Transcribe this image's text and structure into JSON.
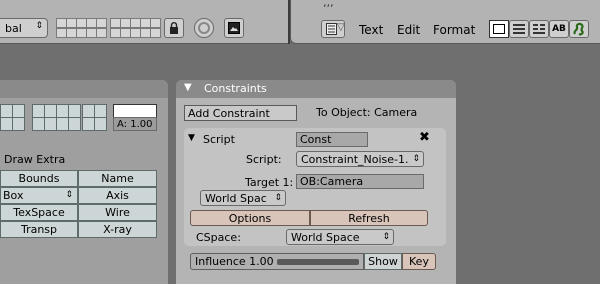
{
  "header_left": {
    "dropdown_value": "bal"
  },
  "header_right": {
    "dots": "‚‚‚",
    "menus": [
      "Text",
      "Edit",
      "Format"
    ],
    "ab_label": "AB"
  },
  "left_panel": {
    "color_value": "A: 1.00",
    "draw_extra_label": "Draw Extra",
    "buttons": [
      [
        "Bounds",
        "Name"
      ],
      [
        "Box",
        "Axis"
      ],
      [
        "TexSpace",
        "Wire"
      ],
      [
        "Transp",
        "X-ray"
      ]
    ]
  },
  "constraints": {
    "panel_title": "Constraints",
    "add_constraint": "Add Constraint",
    "to_object": "To Object: Camera",
    "script": {
      "header_label": "Script",
      "name_value": "Const",
      "script_label": "Script:",
      "script_value": "Constraint_Noise-1.",
      "target_label": "Target 1:",
      "target_value": "OB:Camera",
      "space_value": "World Spac",
      "options_label": "Options",
      "refresh_label": "Refresh",
      "cspace_label": "CSpace:",
      "cspace_value": "World Space"
    },
    "influence_label": "Influence 1.00",
    "show_label": "Show",
    "key_label": "Key"
  },
  "icons": {
    "lock": "lock-icon",
    "close": "close-icon"
  }
}
